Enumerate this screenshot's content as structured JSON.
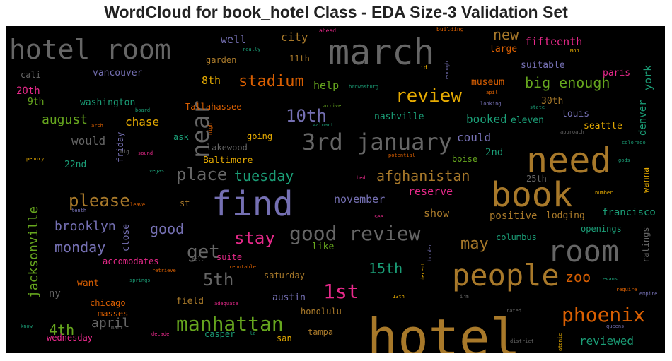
{
  "chart_data": {
    "type": "wordcloud",
    "title": "WordCloud for book_hotel Class - EDA Size-3 Validation Set",
    "background": "#000000",
    "words": [
      {
        "text": "hotel",
        "color": "#a8792a"
      },
      {
        "text": "find",
        "color": "#7570b3"
      },
      {
        "text": "book",
        "color": "#a8792a"
      },
      {
        "text": "need",
        "color": "#a8792a"
      },
      {
        "text": "march",
        "color": "#666666"
      },
      {
        "text": "hotel room",
        "color": "#666666"
      },
      {
        "text": "people",
        "color": "#a8792a"
      },
      {
        "text": "room",
        "color": "#666666"
      },
      {
        "text": "near",
        "color": "#666666"
      },
      {
        "text": "3rd january",
        "color": "#666666"
      },
      {
        "text": "good review",
        "color": "#666666"
      },
      {
        "text": "manhattan",
        "color": "#66a61e"
      },
      {
        "text": "phoenix",
        "color": "#d95f02"
      },
      {
        "text": "review",
        "color": "#e6ab02"
      },
      {
        "text": "1st",
        "color": "#e7298a"
      },
      {
        "text": "place",
        "color": "#666666"
      },
      {
        "text": "10th",
        "color": "#7570b3"
      },
      {
        "text": "stay",
        "color": "#e7298a"
      },
      {
        "text": "get",
        "color": "#666666"
      },
      {
        "text": "5th",
        "color": "#666666"
      },
      {
        "text": "please",
        "color": "#a8792a"
      },
      {
        "text": "afghanistan",
        "color": "#a8792a"
      },
      {
        "text": "may",
        "color": "#a8792a"
      },
      {
        "text": "stadium",
        "color": "#d95f02"
      },
      {
        "text": "big enough",
        "color": "#66a61e"
      },
      {
        "text": "tuesday",
        "color": "#1b9e77"
      },
      {
        "text": "15th",
        "color": "#1b9e77"
      },
      {
        "text": "zoo",
        "color": "#d95f02"
      },
      {
        "text": "jacksonville",
        "color": "#66a61e"
      },
      {
        "text": "brooklyn",
        "color": "#7570b3"
      },
      {
        "text": "good",
        "color": "#7570b3"
      },
      {
        "text": "monday",
        "color": "#7570b3"
      },
      {
        "text": "new",
        "color": "#a8792a"
      },
      {
        "text": "april",
        "color": "#666666"
      },
      {
        "text": "4th",
        "color": "#66a61e"
      },
      {
        "text": "august",
        "color": "#66a61e"
      },
      {
        "text": "chase",
        "color": "#e6ab02"
      },
      {
        "text": "booked",
        "color": "#1b9e77"
      },
      {
        "text": "could",
        "color": "#7570b3"
      },
      {
        "text": "would",
        "color": "#666666"
      },
      {
        "text": "reviewed",
        "color": "#1b9e77"
      },
      {
        "text": "november",
        "color": "#7570b3"
      },
      {
        "text": "reserve",
        "color": "#e7298a"
      },
      {
        "text": "show",
        "color": "#a8792a"
      },
      {
        "text": "positive",
        "color": "#a8792a"
      },
      {
        "text": "lodging",
        "color": "#a8792a"
      },
      {
        "text": "francisco",
        "color": "#1b9e77"
      },
      {
        "text": "help",
        "color": "#66a61e"
      },
      {
        "text": "city",
        "color": "#a8792a"
      },
      {
        "text": "well",
        "color": "#7570b3"
      },
      {
        "text": "fifteenth",
        "color": "#e7298a"
      },
      {
        "text": "large",
        "color": "#d95f02"
      },
      {
        "text": "suitable",
        "color": "#7570b3"
      },
      {
        "text": "paris",
        "color": "#e7298a"
      },
      {
        "text": "york",
        "color": "#1b9e77"
      },
      {
        "text": "museum",
        "color": "#d95f02"
      },
      {
        "text": "30th",
        "color": "#a8792a"
      },
      {
        "text": "louis",
        "color": "#7570b3"
      },
      {
        "text": "denver",
        "color": "#1b9e77"
      },
      {
        "text": "seattle",
        "color": "#e6ab02"
      },
      {
        "text": "eleven",
        "color": "#1b9e77"
      },
      {
        "text": "nashville",
        "color": "#1b9e77"
      },
      {
        "text": "vancouver",
        "color": "#7570b3"
      },
      {
        "text": "washington",
        "color": "#1b9e77"
      },
      {
        "text": "garden",
        "color": "#a8792a"
      },
      {
        "text": "11th",
        "color": "#a8792a"
      },
      {
        "text": "8th",
        "color": "#e6ab02"
      },
      {
        "text": "cali",
        "color": "#666666"
      },
      {
        "text": "20th",
        "color": "#e7298a"
      },
      {
        "text": "9th",
        "color": "#66a61e"
      },
      {
        "text": "Tallahassee",
        "color": "#d95f02"
      },
      {
        "text": "lakewood",
        "color": "#666666"
      },
      {
        "text": "Baltimore",
        "color": "#e6ab02"
      },
      {
        "text": "going",
        "color": "#e6ab02"
      },
      {
        "text": "ask",
        "color": "#1b9e77"
      },
      {
        "text": "friday",
        "color": "#7570b3"
      },
      {
        "text": "22nd",
        "color": "#1b9e77"
      },
      {
        "text": "boise",
        "color": "#66a61e"
      },
      {
        "text": "2nd",
        "color": "#1b9e77"
      },
      {
        "text": "25th",
        "color": "#666666"
      },
      {
        "text": "wanna",
        "color": "#e6ab02"
      },
      {
        "text": "close",
        "color": "#7570b3"
      },
      {
        "text": "st",
        "color": "#a8792a"
      },
      {
        "text": "like",
        "color": "#66a61e"
      },
      {
        "text": "openings",
        "color": "#1b9e77"
      },
      {
        "text": "ratings",
        "color": "#666666"
      },
      {
        "text": "columbus",
        "color": "#1b9e77"
      },
      {
        "text": "accomodates",
        "color": "#e7298a"
      },
      {
        "text": "suite",
        "color": "#e7298a"
      },
      {
        "text": "saturday",
        "color": "#a8792a"
      },
      {
        "text": "want",
        "color": "#d95f02"
      },
      {
        "text": "ny",
        "color": "#666666"
      },
      {
        "text": "austin",
        "color": "#7570b3"
      },
      {
        "text": "chicago",
        "color": "#d95f02"
      },
      {
        "text": "field",
        "color": "#a8792a"
      },
      {
        "text": "masses",
        "color": "#d95f02"
      },
      {
        "text": "honolulu",
        "color": "#a8792a"
      },
      {
        "text": "casper",
        "color": "#1b9e77"
      },
      {
        "text": "tampa",
        "color": "#a8792a"
      },
      {
        "text": "san",
        "color": "#e6ab02"
      },
      {
        "text": "wednesday",
        "color": "#e7298a"
      },
      {
        "text": "ahead",
        "color": "#e7298a"
      },
      {
        "text": "building",
        "color": "#d95f02"
      },
      {
        "text": "really",
        "color": "#1b9e77"
      },
      {
        "text": "Mon",
        "color": "#e6ab02"
      },
      {
        "text": "id",
        "color": "#e6ab02"
      },
      {
        "text": "enough",
        "color": "#7570b3"
      },
      {
        "text": "brownsburg",
        "color": "#1b9e77"
      },
      {
        "text": "apil",
        "color": "#d95f02"
      },
      {
        "text": "arrive",
        "color": "#66a61e"
      },
      {
        "text": "looking",
        "color": "#7570b3"
      },
      {
        "text": "state",
        "color": "#1b9e77"
      },
      {
        "text": "board",
        "color": "#1b9e77"
      },
      {
        "text": "arch",
        "color": "#d95f02"
      },
      {
        "text": "nigh",
        "color": "#d95f02"
      },
      {
        "text": "walmart",
        "color": "#1b9e77"
      },
      {
        "text": "approach",
        "color": "#666666"
      },
      {
        "text": "big",
        "color": "#666666"
      },
      {
        "text": "sound",
        "color": "#e7298a"
      },
      {
        "text": "penury",
        "color": "#e6ab02"
      },
      {
        "text": "potential",
        "color": "#d95f02"
      },
      {
        "text": "colorado",
        "color": "#1b9e77"
      },
      {
        "text": "vegas",
        "color": "#1b9e77"
      },
      {
        "text": "bed",
        "color": "#e7298a"
      },
      {
        "text": "gods",
        "color": "#1b9e77"
      },
      {
        "text": "tenth",
        "color": "#7570b3"
      },
      {
        "text": "leave",
        "color": "#d95f02"
      },
      {
        "text": "number",
        "color": "#e6ab02"
      },
      {
        "text": "see",
        "color": "#e7298a"
      },
      {
        "text": "border",
        "color": "#7570b3"
      },
      {
        "text": "decent",
        "color": "#e6ab02"
      },
      {
        "text": "retrieve",
        "color": "#d95f02"
      },
      {
        "text": "call",
        "color": "#666666"
      },
      {
        "text": "reputable",
        "color": "#d95f02"
      },
      {
        "text": "springs",
        "color": "#1b9e77"
      },
      {
        "text": "evans",
        "color": "#1b9e77"
      },
      {
        "text": "require",
        "color": "#d95f02"
      },
      {
        "text": "empire",
        "color": "#7570b3"
      },
      {
        "text": "13th",
        "color": "#e6ab02"
      },
      {
        "text": "i'm",
        "color": "#666666"
      },
      {
        "text": "adequate",
        "color": "#e7298a"
      },
      {
        "text": "rated",
        "color": "#666666"
      },
      {
        "text": "know",
        "color": "#1b9e77"
      },
      {
        "text": "mart",
        "color": "#666666"
      },
      {
        "text": "decade",
        "color": "#e7298a"
      },
      {
        "text": "la",
        "color": "#1b9e77"
      },
      {
        "text": "atomic",
        "color": "#e6ab02"
      },
      {
        "text": "queens",
        "color": "#7570b3"
      },
      {
        "text": "district",
        "color": "#666666"
      }
    ]
  }
}
